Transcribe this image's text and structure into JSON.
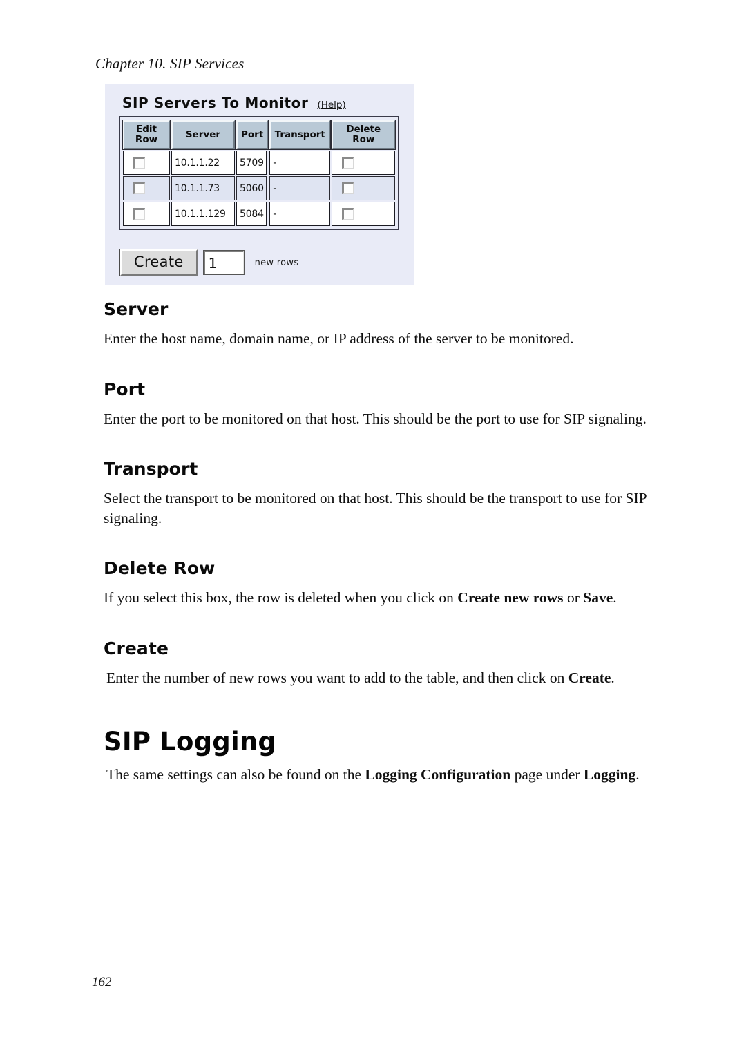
{
  "document": {
    "chapter_header": "Chapter 10. SIP Services",
    "page_number": "162"
  },
  "screenshot": {
    "panel_title": "SIP Servers To Monitor",
    "help_link": "(Help)",
    "table": {
      "columns": [
        {
          "label_line1": "Edit",
          "label_line2": "Row"
        },
        {
          "label_line1": "Server",
          "label_line2": ""
        },
        {
          "label_line1": "Port",
          "label_line2": ""
        },
        {
          "label_line1": "Transport",
          "label_line2": ""
        },
        {
          "label_line1": "Delete",
          "label_line2": "Row"
        }
      ],
      "rows": [
        {
          "edit_row_checked": false,
          "server": "10.1.1.22",
          "port": "5709",
          "transport": "-",
          "delete_row_checked": false
        },
        {
          "edit_row_checked": false,
          "server": "10.1.1.73",
          "port": "5060",
          "transport": "-",
          "delete_row_checked": false
        },
        {
          "edit_row_checked": false,
          "server": "10.1.1.129",
          "port": "5084",
          "transport": "-",
          "delete_row_checked": false
        }
      ]
    },
    "create_button_label": "Create",
    "rows_input_value": "1",
    "rows_label": "new rows",
    "colors": {
      "panel_background": "#e9ebf7",
      "header_cell": "#b9c9d6",
      "alt_row": "#dfe4f2",
      "button_face": "#dcdcdc"
    }
  },
  "sections": {
    "server": {
      "heading": "Server",
      "text": "Enter the host name, domain name, or IP address of the server to be monitored."
    },
    "port": {
      "heading": "Port",
      "text": "Enter the port to be monitored on that host. This should be the port to use for SIP signaling."
    },
    "transport": {
      "heading": "Transport",
      "text": "Select the transport to be monitored on that host. This should be the transport to use for SIP signaling."
    },
    "delete_row": {
      "heading": "Delete Row",
      "text_part1": "If you select this box, the row is deleted when you click on ",
      "bold1": "Create new rows",
      "text_part2": " or ",
      "bold2": "Save",
      "text_part3": "."
    },
    "create": {
      "heading": "Create",
      "text_part1": "Enter the number of new rows you want to add to the table, and then click on ",
      "bold1": "Create",
      "text_part2": "."
    },
    "sip_logging": {
      "heading": "SIP Logging",
      "text_part1": "The same settings can also be found on the ",
      "bold1": "Logging Configuration",
      "text_part2": " page under ",
      "bold2": "Logging",
      "text_part3": "."
    }
  }
}
